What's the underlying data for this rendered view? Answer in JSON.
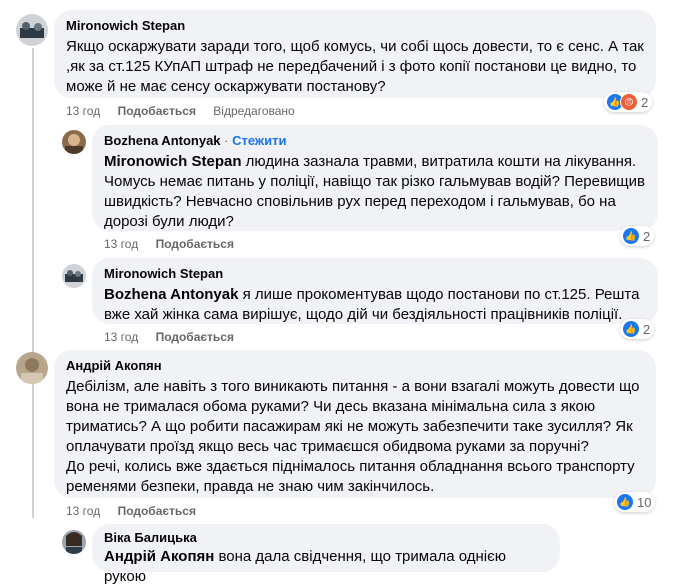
{
  "comments": [
    {
      "author": "Mironowich Stepan",
      "text": "Якщо оскаржувати заради того, щоб комусь, чи собі щось довести, то є сенс. А так ,як за ст.125 КУпАП штраф не передбачений і з фото копії постанови це видно, то може й не має сенсу оскаржувати постанову?",
      "time": "13 год",
      "like": "Подобається",
      "reply": "Відредаговано",
      "reactions_count": "2"
    },
    {
      "author": "Bozhena Antonyak",
      "follow": "Стежити",
      "mention": "Mironowich Stepan",
      "text": " людина зазнала травми, витратила кошти на лікування. Чомусь немає питань у поліції, навіщо так різко гальмував водій? Перевищив швидкість? Невчасно сповільнив рух перед переходом і гальмував, бо на дорозі були люди?",
      "time": "13 год",
      "like": "Подобається",
      "reactions_count": "2"
    },
    {
      "author": "Mironowich Stepan",
      "mention": "Bozhena Antonyak",
      "text": " я лише прокоментував щодо постанови по ст.125. Решта вже хай жінка сама вирішує, щодо дій чи бездіяльності працівників поліції.",
      "time": "13 год",
      "like": "Подобається",
      "reactions_count": "2"
    },
    {
      "author": "Андрій Акопян",
      "text": "Дебілізм, але навіть з того виникають питання - а вони взагалі можуть довести що вона не трималася обома руками? Чи десь вказана мінімальна сила з якою триматись? А що робити пасажирам які не можуть забезпечити таке зусилля? Як оплачувати проїзд якщо весь час тримаєшся обидвома руками за поручні?",
      "text2": "До речі, колись вже здається піднімалось питання обладнання всього транспорту ременями безпеки, правда не знаю чим закінчилось.",
      "time": "13 год",
      "like": "Подобається",
      "reactions_count": "10"
    },
    {
      "author": "Віка Балицька",
      "mention": "Андрій Акопян",
      "text": " вона дала свідчення, що тримала однією рукою"
    }
  ],
  "colors": {
    "bubble": "#f0f2f5",
    "link": "#1b74e4",
    "meta": "#65676b",
    "like": "#1877f2",
    "angry": "#f25c35"
  }
}
